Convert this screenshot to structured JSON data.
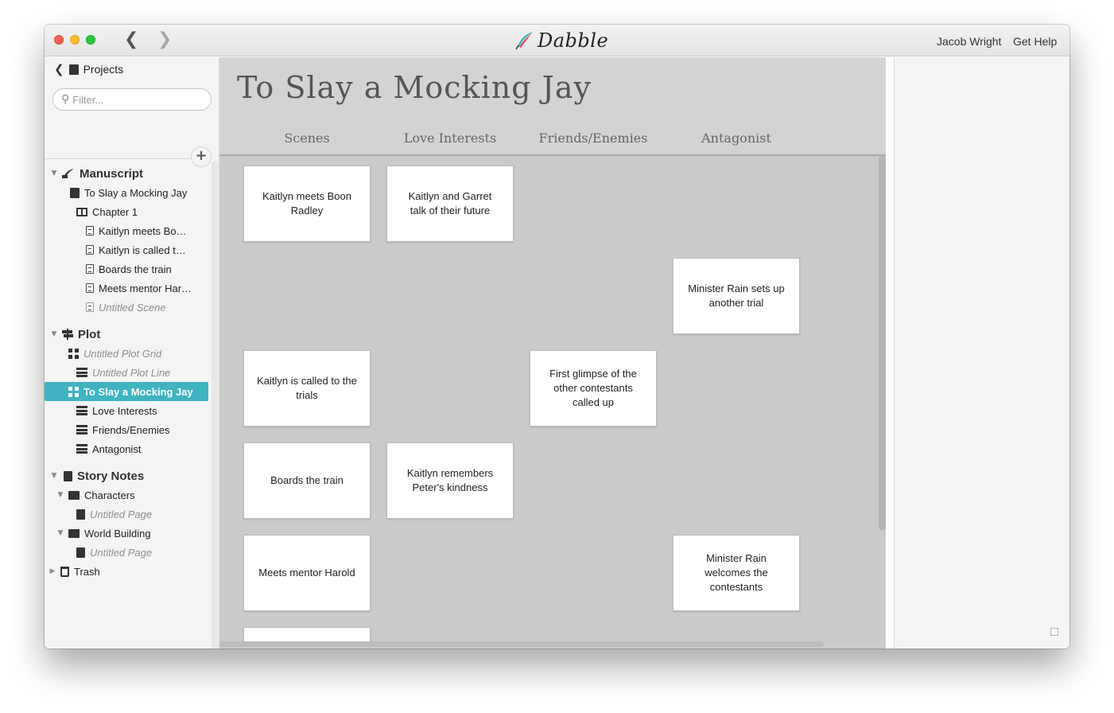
{
  "app": {
    "logo_text": "Dabble",
    "user_name": "Jacob Wright",
    "help_label": "Get Help"
  },
  "sidebar": {
    "projects_label": "Projects",
    "filter_placeholder": "Filter...",
    "sections": {
      "manuscript": "Manuscript",
      "plot": "Plot",
      "story_notes": "Story Notes",
      "trash": "Trash"
    },
    "manuscript_items": {
      "book": "To Slay a Mocking Jay",
      "chapter": "Chapter 1",
      "scene1": "Kaitlyn meets Bo…",
      "scene2": "Kaitlyn is called t…",
      "scene3": "Boards the train",
      "scene4": "Meets mentor Har…",
      "scene5": "Untitled Scene"
    },
    "plot_items": {
      "grid1": "Untitled Plot Grid",
      "line1": "Untitled Plot Line",
      "grid_selected": "To Slay a Mocking Jay",
      "line2": "Love Interests",
      "line3": "Friends/Enemies",
      "line4": "Antagonist"
    },
    "notes_items": {
      "characters": "Characters",
      "characters_page": "Untitled Page",
      "world": "World Building",
      "world_page": "Untitled Page"
    }
  },
  "board": {
    "title": "To Slay a Mocking Jay",
    "columns": [
      "Scenes",
      "Love Interests",
      "Friends/Enemies",
      "Antagonist"
    ],
    "cards": {
      "r0c0": "Kaitlyn meets Boon Radley",
      "r0c1": "Kaitlyn and Garret talk of their future",
      "r1c3": "Minister Rain sets up another trial",
      "r2c0": "Kaitlyn is called to the trials",
      "r2c2": "First glimpse of the other contestants called up",
      "r3c0": "Boards the train",
      "r3c1": "Kaitlyn remembers Peter's kindness",
      "r4c0": "Meets mentor Harold",
      "r4c3": "Minister Rain welcomes the contestants",
      "r5c0": ""
    }
  },
  "colors": {
    "accent": "#3fb3c0",
    "board_bg": "#cbcbcb",
    "sidebar_bg": "#f4f4f4"
  }
}
